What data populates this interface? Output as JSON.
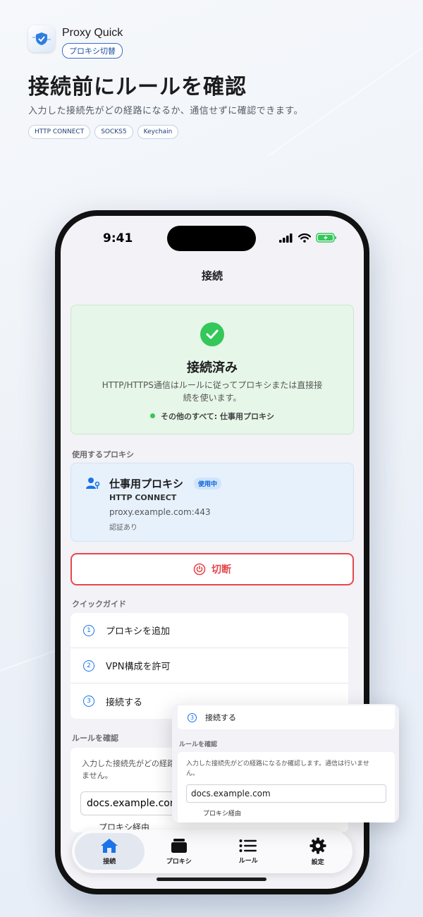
{
  "header": {
    "app_name": "Proxy Quick",
    "app_subtag": "プロキシ切替",
    "headline": "接続前にルールを確認",
    "subline": "入力した接続先がどの経路になるか、通信せずに確認できます。",
    "tags": [
      "HTTP CONNECT",
      "SOCKS5",
      "Keychain"
    ]
  },
  "status_bar": {
    "time": "9:41"
  },
  "nav": {
    "title": "接続"
  },
  "connection": {
    "title": "接続済み",
    "description": "HTTP/HTTPS通信はルールに従ってプロキシまたは直接接続を使います。",
    "rule_summary": "その他のすべて: 仕事用プロキシ",
    "status_color": "#34c759"
  },
  "proxy_section": {
    "label": "使用するプロキシ",
    "name": "仕事用プロキシ",
    "badge": "使用中",
    "type": "HTTP CONNECT",
    "host": "proxy.example.com:443",
    "auth": "認証あり"
  },
  "disconnect": {
    "label": "切断",
    "color": "#e5484d"
  },
  "guide": {
    "label": "クイックガイド",
    "items": [
      {
        "num": "1",
        "label": "プロキシを追加"
      },
      {
        "num": "2",
        "label": "VPN構成を許可"
      },
      {
        "num": "3",
        "label": "接続する"
      }
    ]
  },
  "rule_check": {
    "label": "ルールを確認",
    "description": "入力した接続先がどの経路になるか確認します。通信は行いません。",
    "input_value": "docs.example.com",
    "result": "プロキシ経由"
  },
  "tabs": [
    {
      "label": "接続",
      "icon": "home-icon"
    },
    {
      "label": "プロキシ",
      "icon": "server-icon"
    },
    {
      "label": "ルール",
      "icon": "list-icon"
    },
    {
      "label": "設定",
      "icon": "gear-icon"
    }
  ],
  "accent_color": "#1a73e8"
}
